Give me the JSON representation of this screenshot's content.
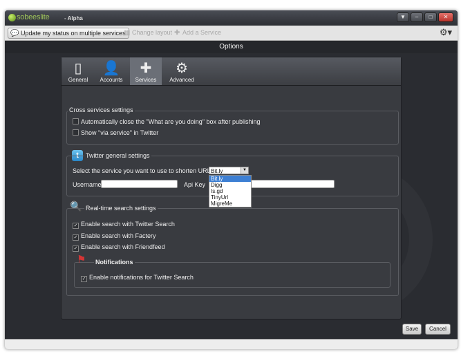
{
  "app": {
    "logo_text": "sobees",
    "logo_suffix": "lite",
    "edition": "- Alpha",
    "window_buttons": [
      "▼",
      "–",
      "□",
      "✕"
    ]
  },
  "toolbar": {
    "update_status_label": "Update my status on multiple services",
    "change_layout_label": "Change layout",
    "add_service_label": "Add a Service",
    "settings_icon": "gear-icon"
  },
  "header": {
    "title": "Options"
  },
  "tabs": [
    {
      "label": "General",
      "icon": "device-icon"
    },
    {
      "label": "Accounts",
      "icon": "user-icon"
    },
    {
      "label": "Services",
      "icon": "puzzle-icon",
      "active": true
    },
    {
      "label": "Advanced",
      "icon": "gears-icon"
    }
  ],
  "cross_services": {
    "title": "Cross services settings",
    "options": [
      {
        "label": "Automatically close the \"What are you doing\" box after publishing",
        "checked": false
      },
      {
        "label": "Show \"via service\" in Twitter",
        "checked": false
      }
    ]
  },
  "twitter": {
    "title": "Twitter general settings",
    "shorten_label": "Select the service you want to use to shorten URLs",
    "shorten_selected": "Bit.ly",
    "shorten_options": [
      "Bit.ly",
      "Digg",
      "Is.gd",
      "TinyUrl",
      "MigreMe"
    ],
    "username_label": "Username",
    "username_value": "",
    "apikey_label": "Api Key",
    "apikey_value": ""
  },
  "realtime": {
    "title": "Real-time search settings",
    "options": [
      {
        "label": "Enable search with Twitter Search",
        "checked": true
      },
      {
        "label": "Enable search with Factery",
        "checked": true
      },
      {
        "label": "Enable search with Friendfeed",
        "checked": true
      }
    ],
    "notifications_title": "Notifications",
    "notifications_options": [
      {
        "label": "Enable notifications for Twitter Search",
        "checked": true
      }
    ]
  },
  "footer": {
    "save_label": "Save",
    "cancel_label": "Cancel"
  }
}
